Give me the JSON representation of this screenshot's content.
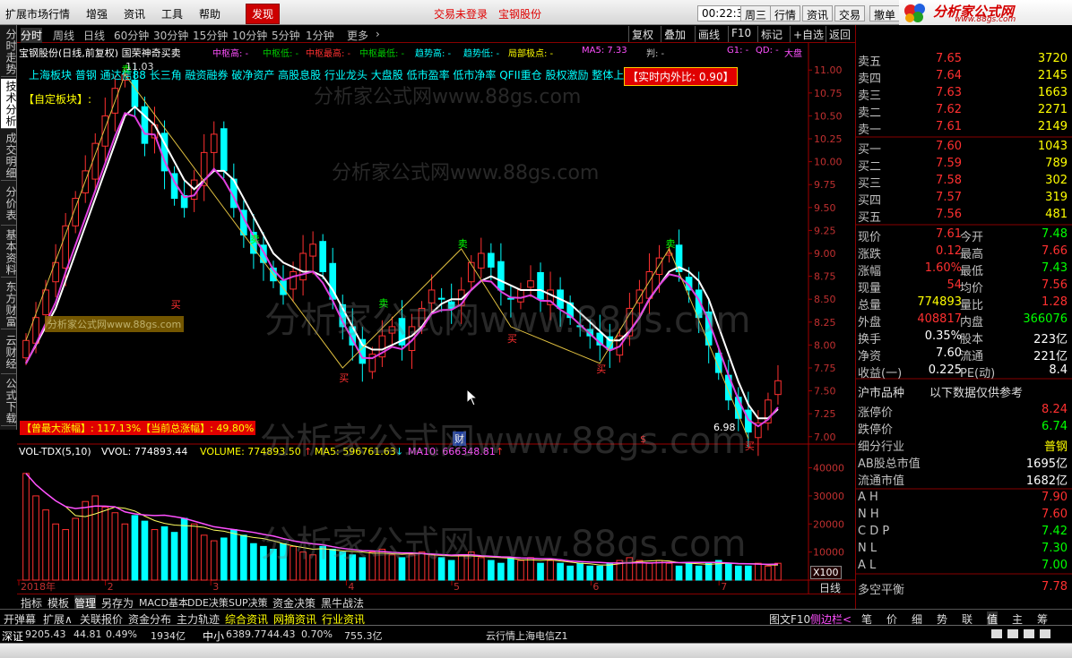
{
  "menubar": {
    "items": [
      "扩展市场行情",
      "增强",
      "资讯",
      "工具",
      "帮助"
    ],
    "active": "发现",
    "login_text": "交易未登录",
    "stock_name": "宝钢股份",
    "clock": "00:22:34",
    "market": "周三",
    "buttons": [
      "行情",
      "资讯",
      "交易",
      "撤单"
    ],
    "logo_text": "分析家公式网",
    "logo_url": "www.88gs.com"
  },
  "left_tabs": [
    "分时走势",
    "技术分析",
    "成交明细",
    "分价表",
    "基本资料",
    "东方财富",
    "云财经",
    "公式下载"
  ],
  "chart_toolbar": {
    "periods": [
      "分时",
      "周线",
      "日线",
      "60分钟",
      "30分钟",
      "15分钟",
      "10分钟",
      "5分钟",
      "1分钟",
      "更多"
    ],
    "right": [
      "复权",
      "叠加",
      "画线",
      "F10",
      "标记",
      "+自选",
      "返回"
    ]
  },
  "indicator_line": {
    "title": "宝钢股份(日线,前复权) 国荣神奇买卖",
    "items": [
      "中枢高: -",
      "中枢低: -",
      "中枢最高: -",
      "中枢最低: -",
      "趋势高: -",
      "趋势低: -",
      "局部极点: -",
      "MA5: 7.33",
      "判: -",
      "G1: -",
      "QD: -",
      "大盘"
    ]
  },
  "concept_tags": "上海板块 普钢 通达信88 长三角 融资融券 破净资产 高股息股 行业龙头 大盘股 低市盈率 低市净率 QFII重仓 股权激励 整体上市",
  "self_sector": "【自定板块】:",
  "ratio_badge": "【实时内外比: 0.90】",
  "high_label": "11.03",
  "low_label": "6.98",
  "amp_text": "【曾最大涨幅】: 117.13%【当前总涨幅】: 49.80%",
  "cai_label": "财",
  "dollar_label": "$",
  "buy_label": "买",
  "sell_label": "卖",
  "price_axis": [
    "11.00",
    "10.75",
    "10.50",
    "10.25",
    "10.00",
    "9.75",
    "9.50",
    "9.25",
    "9.00",
    "8.75",
    "8.50",
    "8.25",
    "8.00",
    "7.75",
    "7.50",
    "7.25",
    "7.00"
  ],
  "vol_axis": [
    "40000",
    "30000",
    "20000",
    "10000"
  ],
  "vol_unit": "X100",
  "vol_line": {
    "name": "VOL-TDX(5,10)",
    "vvol": "VVOL: 774893.44",
    "volume": "VOLUME: 774893.50",
    "ma5": "MA5: 596761.63",
    "ma10": "MA10: 666348.81"
  },
  "date_axis": [
    "2018年",
    "2",
    "3",
    "4",
    "5",
    "6",
    "7"
  ],
  "period_label": "日线",
  "bottom_tabs": [
    "指标",
    "模板",
    "管理",
    "另存为",
    "MACD基本",
    "DDE决策",
    "SUP决策",
    "资金决策",
    "黑牛战法"
  ],
  "bottom_tabs2": [
    "开弹幕",
    "扩展∧",
    "关联报价",
    "资金分布",
    "主力轨迹",
    "综合资讯",
    "网摘资讯",
    "行业资讯"
  ],
  "right_bottom": [
    "图文F10",
    "侧边栏<"
  ],
  "order_book": {
    "asks": [
      {
        "label": "卖五",
        "price": "7.65",
        "vol": "3720"
      },
      {
        "label": "卖四",
        "price": "7.64",
        "vol": "2145"
      },
      {
        "label": "卖三",
        "price": "7.63",
        "vol": "1663"
      },
      {
        "label": "卖二",
        "price": "7.62",
        "vol": "2271"
      },
      {
        "label": "卖一",
        "price": "7.61",
        "vol": "2149"
      }
    ],
    "bids": [
      {
        "label": "买一",
        "price": "7.60",
        "vol": "1043"
      },
      {
        "label": "买二",
        "price": "7.59",
        "vol": "789"
      },
      {
        "label": "买三",
        "price": "7.58",
        "vol": "302"
      },
      {
        "label": "买四",
        "price": "7.57",
        "vol": "319"
      },
      {
        "label": "买五",
        "price": "7.56",
        "vol": "481"
      }
    ]
  },
  "quote": [
    {
      "l1": "现价",
      "v1": "7.61",
      "l2": "今开",
      "v2": "7.48"
    },
    {
      "l1": "涨跌",
      "v1": "0.12",
      "l2": "最高",
      "v2": "7.66"
    },
    {
      "l1": "涨幅",
      "v1": "1.60%",
      "l2": "最低",
      "v2": "7.43"
    },
    {
      "l1": "现量",
      "v1": "54",
      "l2": "均价",
      "v2": "7.56"
    },
    {
      "l1": "总量",
      "v1": "774893",
      "l2": "量比",
      "v2": "1.28"
    },
    {
      "l1": "外盘",
      "v1": "408817",
      "l2": "内盘",
      "v2": "366076"
    },
    {
      "l1": "换手",
      "v1": "0.35%",
      "l2": "股本",
      "v2": "223亿"
    },
    {
      "l1": "净资",
      "v1": "7.60",
      "l2": "流通",
      "v2": "221亿"
    },
    {
      "l1": "收益(一)",
      "v1": "0.225",
      "l2": "PE(动)",
      "v2": "8.4"
    }
  ],
  "info_header": {
    "left": "沪市品种",
    "right": "以下数据仅供参考"
  },
  "info_rows": [
    {
      "l": "涨停价",
      "v": "8.24"
    },
    {
      "l": "跌停价",
      "v": "6.74"
    },
    {
      "l": "细分行业",
      "v": "普钢"
    },
    {
      "l": "AB股总市值",
      "v": "1695亿"
    },
    {
      "l": "流通市值",
      "v": "1682亿"
    }
  ],
  "index_rows": [
    {
      "l": "AH",
      "v": "7.90"
    },
    {
      "l": "NH",
      "v": "7.60"
    },
    {
      "l": "CDP",
      "v": "7.42"
    },
    {
      "l": "NL",
      "v": "7.30"
    },
    {
      "l": "AL",
      "v": "7.00"
    }
  ],
  "balance": {
    "l": "多空平衡",
    "v": "7.78"
  },
  "right_tabs": [
    "笔",
    "价",
    "细",
    "势",
    "联",
    "值",
    "主",
    "筹"
  ],
  "status": {
    "sz_label": "深证",
    "sz_val": "9205.43",
    "sz_chg": "44.81",
    "sz_pct": "0.49%",
    "sz_amt": "1934亿",
    "zx_label": "中小",
    "zx_val": "6389.77",
    "zx_chg": "44.43",
    "zx_pct": "0.70%",
    "zx_amt": "755.3亿",
    "server": "云行情上海电信Z1"
  },
  "watermark": "分析家公式网www.88gs.com",
  "watermark_small": "分析家公式网www.88gs.com",
  "chart_data": {
    "type": "candlestick",
    "title": "宝钢股份(日线,前复权)",
    "ylim": [
      6.9,
      11.1
    ],
    "close": [
      8.05,
      8.3,
      8.6,
      8.9,
      9.3,
      9.6,
      9.9,
      10.2,
      10.5,
      10.8,
      10.95,
      10.6,
      10.2,
      10.4,
      9.9,
      9.6,
      9.5,
      9.8,
      10.1,
      10.3,
      9.9,
      9.5,
      9.2,
      9.0,
      8.9,
      8.7,
      8.55,
      8.8,
      9.0,
      9.1,
      8.8,
      8.5,
      8.2,
      8.0,
      7.8,
      7.9,
      8.1,
      8.2,
      8.0,
      8.2,
      8.4,
      8.6,
      8.5,
      8.4,
      8.6,
      8.9,
      9.0,
      8.85,
      8.6,
      8.5,
      8.6,
      8.7,
      8.5,
      8.6,
      8.4,
      8.3,
      8.2,
      8.1,
      8.0,
      7.95,
      8.1,
      8.4,
      8.6,
      8.8,
      8.95,
      9.0,
      8.8,
      8.6,
      8.3,
      8.0,
      7.7,
      7.4,
      7.2,
      7.05,
      7.15,
      7.4,
      7.61
    ],
    "ma_white": [
      7.8,
      8.0,
      8.2,
      8.4,
      8.7,
      9.0,
      9.3,
      9.6,
      9.9,
      10.2,
      10.5,
      10.6,
      10.5,
      10.4,
      10.2,
      10.0,
      9.8,
      9.7,
      9.8,
      9.9,
      9.9,
      9.8,
      9.6,
      9.4,
      9.2,
      9.0,
      8.9,
      8.85,
      8.8,
      8.8,
      8.75,
      8.6,
      8.4,
      8.2,
      8.0,
      7.95,
      7.95,
      8.0,
      8.05,
      8.1,
      8.2,
      8.35,
      8.45,
      8.5,
      8.5,
      8.6,
      8.7,
      8.75,
      8.7,
      8.65,
      8.6,
      8.6,
      8.6,
      8.55,
      8.5,
      8.45,
      8.35,
      8.25,
      8.15,
      8.05,
      8.05,
      8.15,
      8.3,
      8.5,
      8.65,
      8.8,
      8.85,
      8.8,
      8.7,
      8.5,
      8.2,
      7.9,
      7.6,
      7.35,
      7.2,
      7.2,
      7.3
    ],
    "vol_h": [
      38,
      30,
      25,
      20,
      18,
      22,
      28,
      30,
      26,
      24,
      20,
      23,
      21,
      18,
      19,
      17,
      22,
      20,
      16,
      14,
      15,
      18,
      16,
      13,
      12,
      11,
      13,
      12,
      10,
      9,
      12,
      11,
      10,
      9,
      8,
      10,
      11,
      9,
      8,
      9,
      10,
      9,
      8,
      7,
      9,
      10,
      8,
      7,
      6,
      8,
      7,
      8,
      6,
      7,
      6,
      5,
      6,
      5,
      5,
      6,
      7,
      8,
      7,
      6,
      7,
      6,
      5,
      6,
      5,
      6,
      7,
      6,
      5,
      5,
      6,
      5,
      6
    ]
  }
}
